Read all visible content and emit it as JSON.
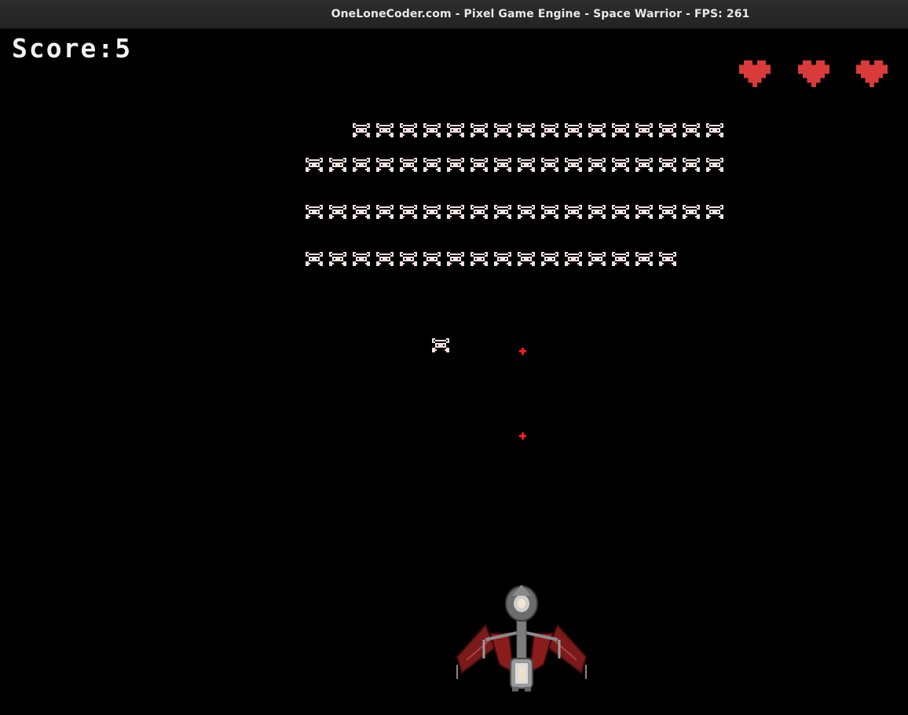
{
  "window": {
    "title": "OneLoneCoder.com - Pixel Game Engine - Space Warrior - FPS: 261"
  },
  "hud": {
    "score_text": "Score:5",
    "lives": 3
  },
  "colors": {
    "background": "#000000",
    "alien": "#f0e0e0",
    "heart": "#d93a3a",
    "bullet": "#ff1a1a",
    "ship_body": "#8a8a8a",
    "ship_wing": "#8b1c1c"
  },
  "icons": {
    "life": "heart-icon",
    "enemy": "alien-invader-icon",
    "player": "spaceship-icon",
    "projectile": "bullet-icon"
  },
  "formation": {
    "rows": [
      {
        "alien_count": 16
      },
      {
        "alien_count": 18
      },
      {
        "alien_count": 18
      },
      {
        "alien_count": 16
      }
    ]
  },
  "stray_aliens": 1,
  "enemy_bullets": 2
}
